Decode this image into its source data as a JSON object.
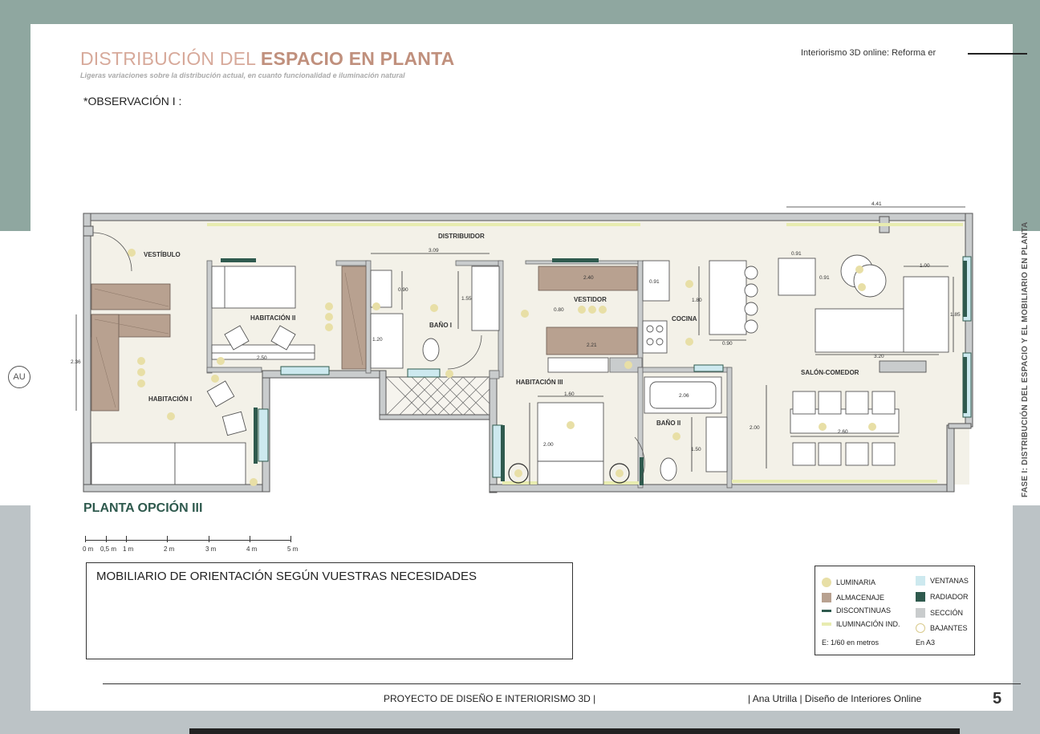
{
  "header": {
    "title_light": "DISTRIBUCIÓN DEL ",
    "title_bold": "ESPACIO EN PLANTA",
    "subtitle": "Ligeras variaciones sobre la distribución actual, en cuanto funcionalidad e iluminación natural",
    "observation": "*OBSERVACIÓN I :",
    "top_right": "Interiorismo 3D online: Reforma er"
  },
  "side_label": "FASE I: DISTRIBUCIÓN DEL ESPACIO Y EL MOBILIARIO EN PLANTA",
  "logo": "AU",
  "plan": {
    "title": "PLANTA OPCIÓN III",
    "rooms": {
      "vestibulo": "VESTÍBULO",
      "distribuidor": "DISTRIBUIDOR",
      "habitacion_ii": "HABITACIÓN II",
      "habitacion_i": "HABITACIÓN I",
      "bano_i": "BAÑO I",
      "vestidor": "VESTIDOR",
      "cocina": "COCINA",
      "habitacion_iii": "HABITACIÓN III",
      "bano_ii": "BAÑO II",
      "salon_comedor": "SALÓN-COMEDOR"
    },
    "dimensions": {
      "d_441": "4.41",
      "d_309": "3.09",
      "d_090a": "0.90",
      "d_155": "1.55",
      "d_120": "1.20",
      "d_236": "2.36",
      "d_250": "2.50",
      "d_240": "2.40",
      "d_080": "0.80",
      "d_221": "2.21",
      "d_091a": "0.91",
      "d_180": "1.80",
      "d_090b": "0.90",
      "d_091b": "0.91",
      "d_091c": "0.91",
      "d_100": "1.00",
      "d_185": "1.85",
      "d_320": "3.20",
      "d_160": "1.60",
      "d_200a": "2.00",
      "d_206": "2.06",
      "d_150": "1.50",
      "d_200b": "2.00",
      "d_260": "2.60"
    }
  },
  "scale": {
    "labels": [
      "0 m",
      "0,5 m",
      "1 m",
      "2 m",
      "3 m",
      "4 m",
      "5 m"
    ]
  },
  "notes": {
    "title": "MOBILIARIO DE ORIENTACIÓN SEGÚN VUESTRAS NECESIDADES"
  },
  "legend": {
    "luminaria": "LUMINARIA",
    "almacenaje": "ALMACENAJE",
    "discontinuas": "DISCONTINUAS",
    "iluminacion": "ILUMINACIÓN IND.",
    "ventanas": "VENTANAS",
    "radiador": "RADIADOR",
    "seccion": "SECCIÓN",
    "bajantes": "BAJANTES",
    "scale_note": "E: 1/60 en metros",
    "paper_note": "En A3",
    "colors": {
      "luminaria": "#e8dfa6",
      "almacenaje": "#b8a190",
      "discontinuas": "#2f5a4e",
      "iluminacion": "#e8ecb0",
      "ventanas": "#cde9ef",
      "radiador": "#2f5a4e",
      "seccion": "#c9cccd",
      "bajantes": "#e8dfa6"
    }
  },
  "footer": {
    "left": "PROYECTO DE DISEÑO E INTERIORISMO 3D |",
    "right": "| Ana Utrilla | Diseño de Interiores Online",
    "page": "5"
  }
}
